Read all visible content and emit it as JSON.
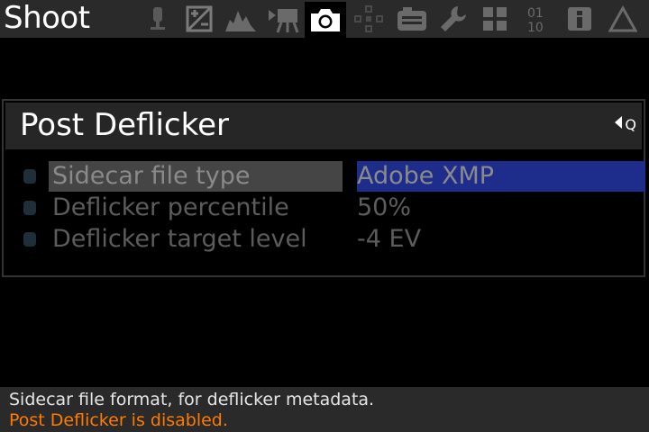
{
  "header": {
    "title": "Shoot",
    "tabs": [
      {
        "icon": "audio-icon",
        "active": false
      },
      {
        "icon": "exposure-icon",
        "active": false
      },
      {
        "icon": "histogram-icon",
        "active": false
      },
      {
        "icon": "movie-icon",
        "active": false
      },
      {
        "icon": "camera-icon",
        "active": true
      },
      {
        "icon": "focus-icon",
        "active": false
      },
      {
        "icon": "display-icon",
        "active": false
      },
      {
        "icon": "wrench-icon",
        "active": false
      },
      {
        "icon": "modules-icon",
        "active": false
      },
      {
        "icon": "debug-icon",
        "active": false
      },
      {
        "icon": "info-icon",
        "active": false
      },
      {
        "icon": "delta-icon",
        "active": false
      }
    ]
  },
  "submenu": {
    "title": "Post Deflicker",
    "q_hint": "Q",
    "items": [
      {
        "label": "Sidecar file type",
        "value": "Adobe XMP",
        "selected": true
      },
      {
        "label": "Deflicker percentile",
        "value": "50%",
        "selected": false
      },
      {
        "label": "Deflicker target level",
        "value": "-4 EV",
        "selected": false
      }
    ]
  },
  "help": {
    "line1": "Sidecar file format, for deflicker metadata.",
    "line2": "Post Deflicker is disabled."
  },
  "colors": {
    "warning": "#ff7a00",
    "selected_value_bg": "#1e2c8c"
  }
}
